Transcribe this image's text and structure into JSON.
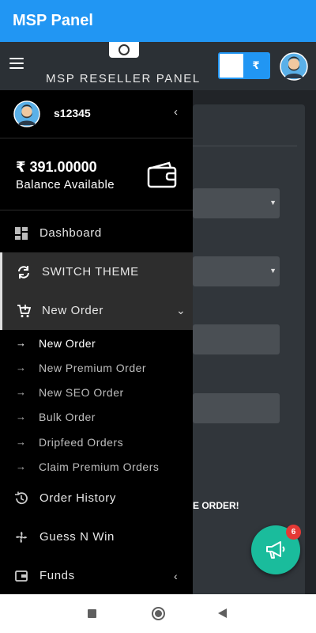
{
  "appbar": {
    "title": "MSP Panel"
  },
  "header": {
    "title": "MSP RESELLER PANEL",
    "currency_symbol": "₹"
  },
  "drawer": {
    "username": "s12345",
    "balance_amount": "₹ 391.00000",
    "balance_label": "Balance Available",
    "menu": {
      "dashboard": "Dashboard",
      "switch_theme": "SWITCH THEME",
      "new_order": "New Order",
      "order_history": "Order History",
      "guess_n_win": "Guess N Win",
      "funds": "Funds"
    },
    "submenu": [
      {
        "label": "New Order"
      },
      {
        "label": "New Premium Order"
      },
      {
        "label": "New SEO Order"
      },
      {
        "label": "Bulk Order"
      },
      {
        "label": "Dripfeed Orders"
      },
      {
        "label": "Claim Premium Orders"
      }
    ]
  },
  "page": {
    "partial_text": "E ORDER!"
  },
  "fab": {
    "badge_count": "6"
  },
  "colors": {
    "appbar": "#2196f3",
    "fab": "#1abc9c",
    "badge": "#e53935"
  }
}
